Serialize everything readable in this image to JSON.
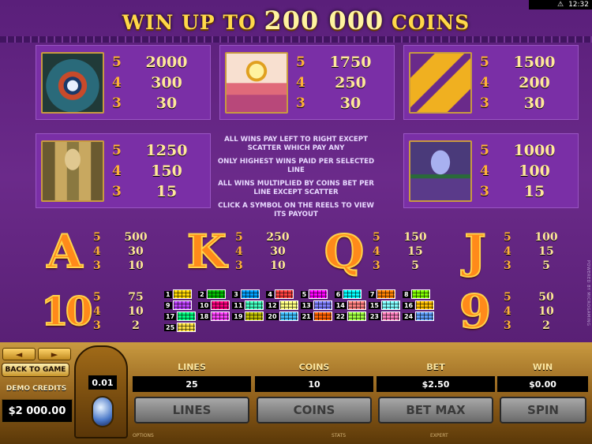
{
  "status": {
    "time": "12:32"
  },
  "header": {
    "prefix": "WIN UP TO",
    "amount": "200 000",
    "suffix": "COINS"
  },
  "symbols": [
    {
      "name": "eye of horus",
      "pays": [
        [
          "5",
          "2000"
        ],
        [
          "4",
          "300"
        ],
        [
          "3",
          "30"
        ]
      ],
      "color": "#3a6a5a"
    },
    {
      "name": "sun disc",
      "pays": [
        [
          "5",
          "1750"
        ],
        [
          "4",
          "250"
        ],
        [
          "3",
          "30"
        ]
      ],
      "color": "#c05a6a"
    },
    {
      "name": "golden wings",
      "pays": [
        [
          "5",
          "1500"
        ],
        [
          "4",
          "200"
        ],
        [
          "3",
          "30"
        ]
      ],
      "color": "#8a4aa8"
    },
    {
      "name": "canopic jars",
      "pays": [
        [
          "5",
          "1250"
        ],
        [
          "4",
          "150"
        ],
        [
          "3",
          "15"
        ]
      ],
      "color": "#7a6a3a"
    },
    {
      "name": "lotus flower",
      "pays": [
        [
          "5",
          "1000"
        ],
        [
          "4",
          "100"
        ],
        [
          "3",
          "15"
        ]
      ],
      "color": "#6a4a8a"
    }
  ],
  "rules": [
    "ALL WINS PAY LEFT TO RIGHT EXCEPT SCATTER WHICH PAY ANY",
    "ONLY HIGHEST WINS PAID PER SELECTED LINE",
    "ALL WINS MULTIPLIED BY COINS BET PER LINE EXCEPT SCATTER",
    "CLICK A SYMBOL ON THE REELS TO VIEW ITS PAYOUT"
  ],
  "letters": [
    {
      "glyph": "A",
      "pays": [
        [
          "5",
          "500"
        ],
        [
          "4",
          "30"
        ],
        [
          "3",
          "10"
        ]
      ]
    },
    {
      "glyph": "K",
      "pays": [
        [
          "5",
          "250"
        ],
        [
          "4",
          "30"
        ],
        [
          "3",
          "10"
        ]
      ]
    },
    {
      "glyph": "Q",
      "pays": [
        [
          "5",
          "150"
        ],
        [
          "4",
          "15"
        ],
        [
          "3",
          "5"
        ]
      ]
    },
    {
      "glyph": "J",
      "pays": [
        [
          "5",
          "100"
        ],
        [
          "4",
          "15"
        ],
        [
          "3",
          "5"
        ]
      ]
    },
    {
      "glyph": "10",
      "pays": [
        [
          "5",
          "75"
        ],
        [
          "4",
          "10"
        ],
        [
          "3",
          "2"
        ]
      ]
    },
    {
      "glyph": "9",
      "pays": [
        [
          "5",
          "50"
        ],
        [
          "4",
          "10"
        ],
        [
          "3",
          "2"
        ]
      ]
    }
  ],
  "paylines": [
    "1",
    "2",
    "3",
    "4",
    "5",
    "6",
    "7",
    "8",
    "9",
    "10",
    "11",
    "12",
    "13",
    "14",
    "15",
    "16",
    "17",
    "18",
    "19",
    "20",
    "21",
    "22",
    "23",
    "24",
    "25"
  ],
  "payline_colors": [
    "#ffd800",
    "#00c000",
    "#00a0ff",
    "#ff4040",
    "#ff00ff",
    "#00ffff",
    "#ff8000",
    "#80ff00",
    "#c040ff",
    "#ff0080",
    "#40ffc0",
    "#ffff80",
    "#8080ff",
    "#ff8080",
    "#80ffff",
    "#ffc000",
    "#00ff80",
    "#ff40ff",
    "#c0c000",
    "#40c0ff",
    "#ff6000",
    "#a0ff40",
    "#ff80c0",
    "#60a0ff",
    "#ffe040"
  ],
  "side_tag": "POWERED BY MICROGAMING",
  "controls": {
    "prev": "◄",
    "next": "►",
    "back": "BACK TO GAME",
    "credits_label": "DEMO CREDITS",
    "credits_value": "$2 000.00",
    "coin_size": "0.01",
    "stats": [
      {
        "label": "LINES",
        "value": "25",
        "button": "LINES"
      },
      {
        "label": "COINS",
        "value": "10",
        "button": "COINS"
      },
      {
        "label": "BET",
        "value": "$2.50",
        "button": "BET MAX"
      },
      {
        "label": "WIN",
        "value": "$0.00",
        "button": "SPIN"
      }
    ],
    "footer": [
      "OPTIONS",
      "STATS",
      "EXPERT"
    ]
  }
}
